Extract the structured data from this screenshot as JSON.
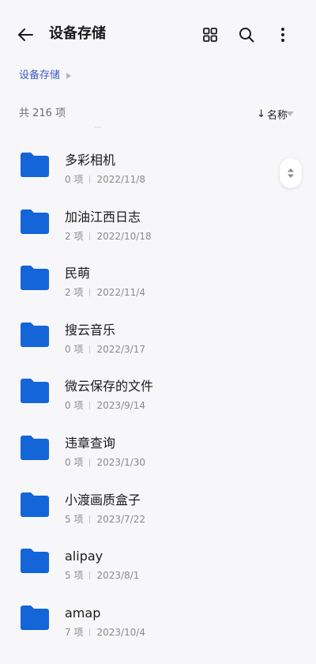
{
  "header": {
    "title": "设备存储",
    "icons": [
      "back-arrow-icon",
      "grid-view-icon",
      "search-icon",
      "more-vert-icon"
    ]
  },
  "breadcrumb": {
    "items": [
      "设备存储"
    ]
  },
  "summary": {
    "count_text": "共 216 项",
    "sort_label": "名称",
    "sort_arrow": "↓"
  },
  "colors": {
    "accent": "#3b5bbf",
    "folder": "#1565d8",
    "background": "#f7f7f9"
  },
  "files": [
    {
      "name": "多彩相机",
      "count": "0 项",
      "date": "2022/11/8"
    },
    {
      "name": "加油江西日志",
      "count": "2 项",
      "date": "2022/10/18"
    },
    {
      "name": "民萌",
      "count": "2 项",
      "date": "2022/11/4"
    },
    {
      "name": "搜云音乐",
      "count": "0 项",
      "date": "2022/3/17"
    },
    {
      "name": "微云保存的文件",
      "count": "0 项",
      "date": "2023/9/14"
    },
    {
      "name": "违章查询",
      "count": "0 项",
      "date": "2023/1/30"
    },
    {
      "name": "小渡画质盒子",
      "count": "5 项",
      "date": "2023/7/22"
    },
    {
      "name": "alipay",
      "count": "5 项",
      "date": "2023/8/1"
    },
    {
      "name": "amap",
      "count": "7 项",
      "date": "2023/10/4"
    }
  ]
}
